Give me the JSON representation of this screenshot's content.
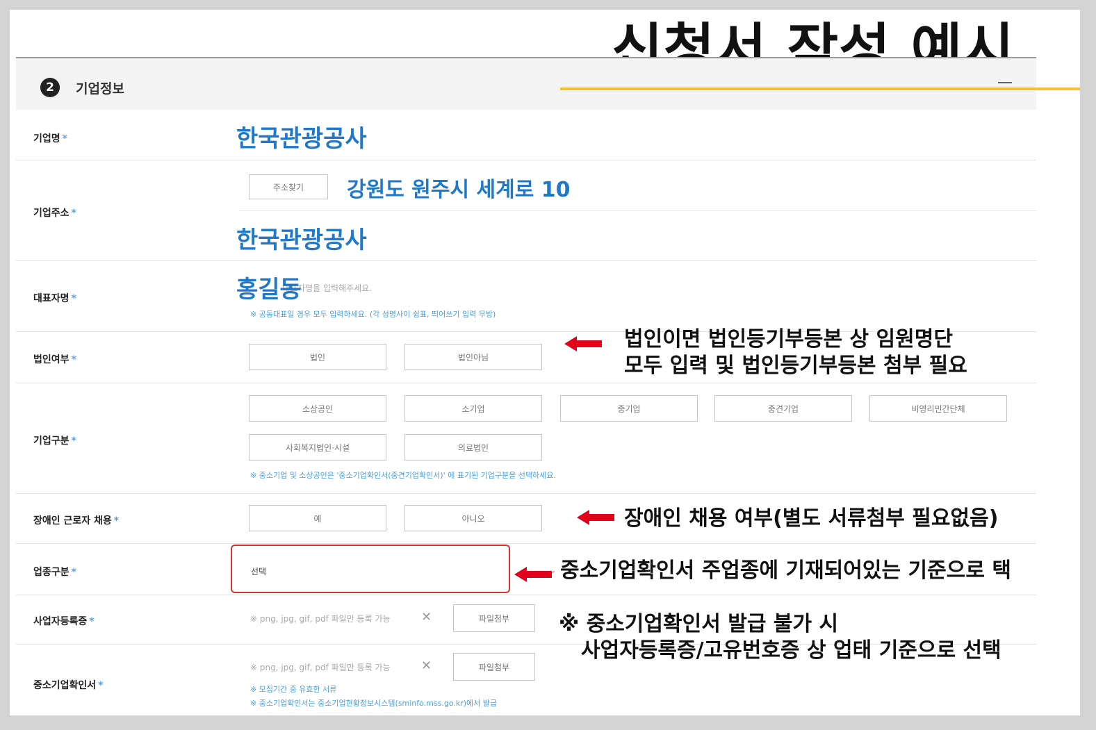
{
  "slide_title": "신청서 작성 예시",
  "section": {
    "number": "2",
    "title": "기업정보"
  },
  "fields": {
    "company_name": {
      "label": "기업명",
      "value": "한국관광공사"
    },
    "address": {
      "label": "기업주소",
      "search_button": "주소찾기",
      "value_line1": "강원도 원주시 세계로 10",
      "value_line2": "한국관광공사"
    },
    "representative": {
      "label": "대표자명",
      "value": "홍길동",
      "placeholder": "대표자명을 입력해주세요.",
      "hint": "※ 공동대표일 경우 모두 입력하세요. (각 성명사이 쉼표, 띄어쓰기 입력 무방)"
    },
    "corporation": {
      "label": "법인여부",
      "options": [
        "법인",
        "법인아님"
      ]
    },
    "company_type": {
      "label": "기업구분",
      "options": [
        "소상공인",
        "소기업",
        "중기업",
        "중견기업",
        "비영리민간단체",
        "사회복지법인·시설",
        "의료법인"
      ],
      "hint": "※ 중소기업 및 소상공인은 '중소기업확인서(중견기업확인서)' 에 표기된 기업구분을 선택하세요."
    },
    "disabled_employment": {
      "label": "장애인 근로자 채용",
      "options": [
        "예",
        "아니오"
      ]
    },
    "industry": {
      "label": "업종구분",
      "selected": "선택"
    },
    "business_registration": {
      "label": "사업자등록증",
      "placeholder": "※ png, jpg, gif, pdf 파일만 등록 가능",
      "button": "파일첨부"
    },
    "sme_certificate": {
      "label": "중소기업확인서",
      "placeholder": "※ png, jpg, gif, pdf 파일만 등록 가능",
      "button": "파일첨부",
      "hint1": "※ 모집기간 중 유효한 서류",
      "hint2": "※ 중소기업확인서는 중소기업현황정보시스템(sminfo.mss.go.kr)에서 발급"
    }
  },
  "required_mark": "*",
  "annotations": {
    "corporation_line1": "법인이면 법인등기부등본 상 임원명단",
    "corporation_line2": "모두 입력 및 법인등기부등본 첨부 필요",
    "disabled": "장애인 채용 여부(별도 서류첨부 필요없음)",
    "industry": "중소기업확인서 주업종에 기재되어있는 기준으로 택",
    "sme_line1": "※ 중소기업확인서 발급 불가 시",
    "sme_line2": "사업자등록증/고유번호증 상 업태 기준으로 선택"
  },
  "colors": {
    "accent_blue": "#1f78c8",
    "highlight_red": "#d8342f",
    "underline_yellow": "#f2c232"
  }
}
